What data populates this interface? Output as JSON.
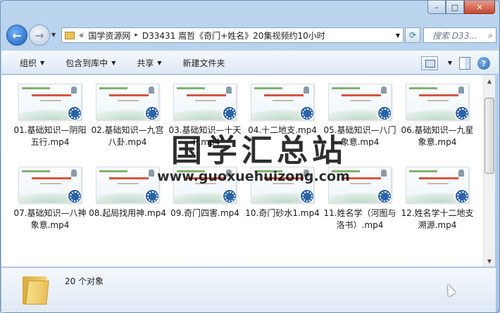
{
  "window": {
    "controls": {
      "minimize": "–",
      "maximize": "□",
      "close": "✕"
    }
  },
  "nav": {
    "back_icon": "←",
    "forward_icon": "→",
    "history_icon": "▼",
    "address": {
      "prefix": "«",
      "crumbs": [
        "国学资源网",
        "D33431 嵩哲《奇门+姓名》20集视频约10小时"
      ],
      "separator": "▸",
      "dropdown": "▼"
    },
    "refresh_icon": "⟳",
    "search": {
      "placeholder": "搜索 D33...",
      "icon": "🔍"
    }
  },
  "toolbar": {
    "items": [
      {
        "label": "组织",
        "arrow": "▼"
      },
      {
        "label": "包含到库中",
        "arrow": "▼"
      },
      {
        "label": "共享",
        "arrow": "▼"
      },
      {
        "label": "新建文件夹",
        "arrow": ""
      }
    ],
    "view_dropdown": "▼",
    "help": "?"
  },
  "files": [
    {
      "name": "01.基础知识—阴阳五行.mp4"
    },
    {
      "name": "02.基础知识—九宫八卦.mp4"
    },
    {
      "name": "03.基础知识—十天干.mp4"
    },
    {
      "name": "04.十二地支.mp4"
    },
    {
      "name": "05.基础知识—八门象意.mp4"
    },
    {
      "name": "06.基础知识—九星象意.mp4"
    },
    {
      "name": "07.基础知识—八神象意.mp4"
    },
    {
      "name": "08.起局找用神.mp4"
    },
    {
      "name": "09.奇门四害.mp4"
    },
    {
      "name": "10.奇门砂水1.mp4"
    },
    {
      "name": "11.姓名学（河图与洛书）.mp4"
    },
    {
      "name": "12.姓名学十二地支溯源.mp4"
    }
  ],
  "scrollbar": {
    "up": "▲",
    "down": "▼"
  },
  "status": {
    "count": "20 个对象"
  },
  "watermark": {
    "title": "国学汇总站",
    "url": "www.guoxuehuizong.com"
  }
}
